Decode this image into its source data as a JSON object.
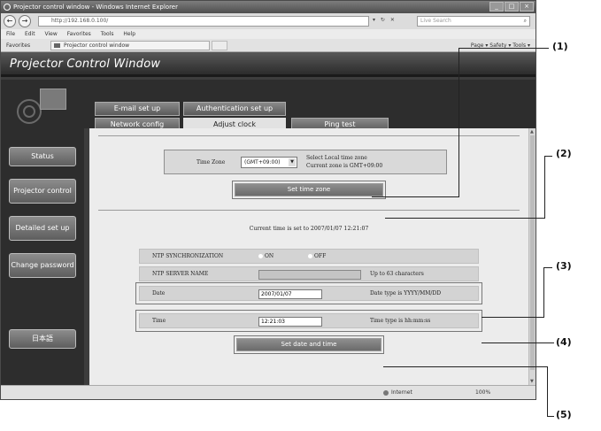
{
  "browser": {
    "title": "Projector control window - Windows Internet Explorer",
    "address": "http://192.168.0.100/",
    "search_placeholder": "Live Search",
    "menu": [
      "File",
      "Edit",
      "View",
      "Favorites",
      "Tools",
      "Help"
    ],
    "favorites_label": "Favorites",
    "tab_label": "Projector control window",
    "toolbar_right": "Page ▾  Safety ▾  Tools ▾",
    "status_zone": "Internet",
    "status_zoom": "100%"
  },
  "page": {
    "banner_title": "Projector Control Window",
    "sidebar": {
      "status": "Status",
      "projector_control": "Projector control",
      "detailed_setup": "Detailed set up",
      "change_password": "Change password",
      "language": "日本語"
    },
    "tabs": {
      "email": "E-mail set up",
      "auth": "Authentication set up",
      "network": "Network config",
      "adjust_clock": "Adjust clock",
      "ping": "Ping test"
    },
    "timezone": {
      "label": "Time Zone",
      "value": "(GMT+09:00)",
      "hint_line1": "Select Local time zone",
      "hint_line2": "Current zone is GMT+09:00",
      "button": "Set time zone"
    },
    "current_time": "Current time is set to 2007/01/07 12:21:07",
    "ntp": {
      "sync_label": "NTP SYNCHRONIZATION",
      "on_label": "ON",
      "off_label": "OFF",
      "server_label": "NTP SERVER NAME",
      "server_hint": "Up to 63 characters"
    },
    "date": {
      "label": "Date",
      "value": "2007/01/07",
      "hint": "Date type is YYYY/MM/DD"
    },
    "time": {
      "label": "Time",
      "value": "12:21:03",
      "hint": "Time type is hh:mm:ss"
    },
    "set_datetime_button": "Set date and time"
  },
  "callouts": [
    "(1)",
    "(2)",
    "(3)",
    "(4)",
    "(5)"
  ]
}
